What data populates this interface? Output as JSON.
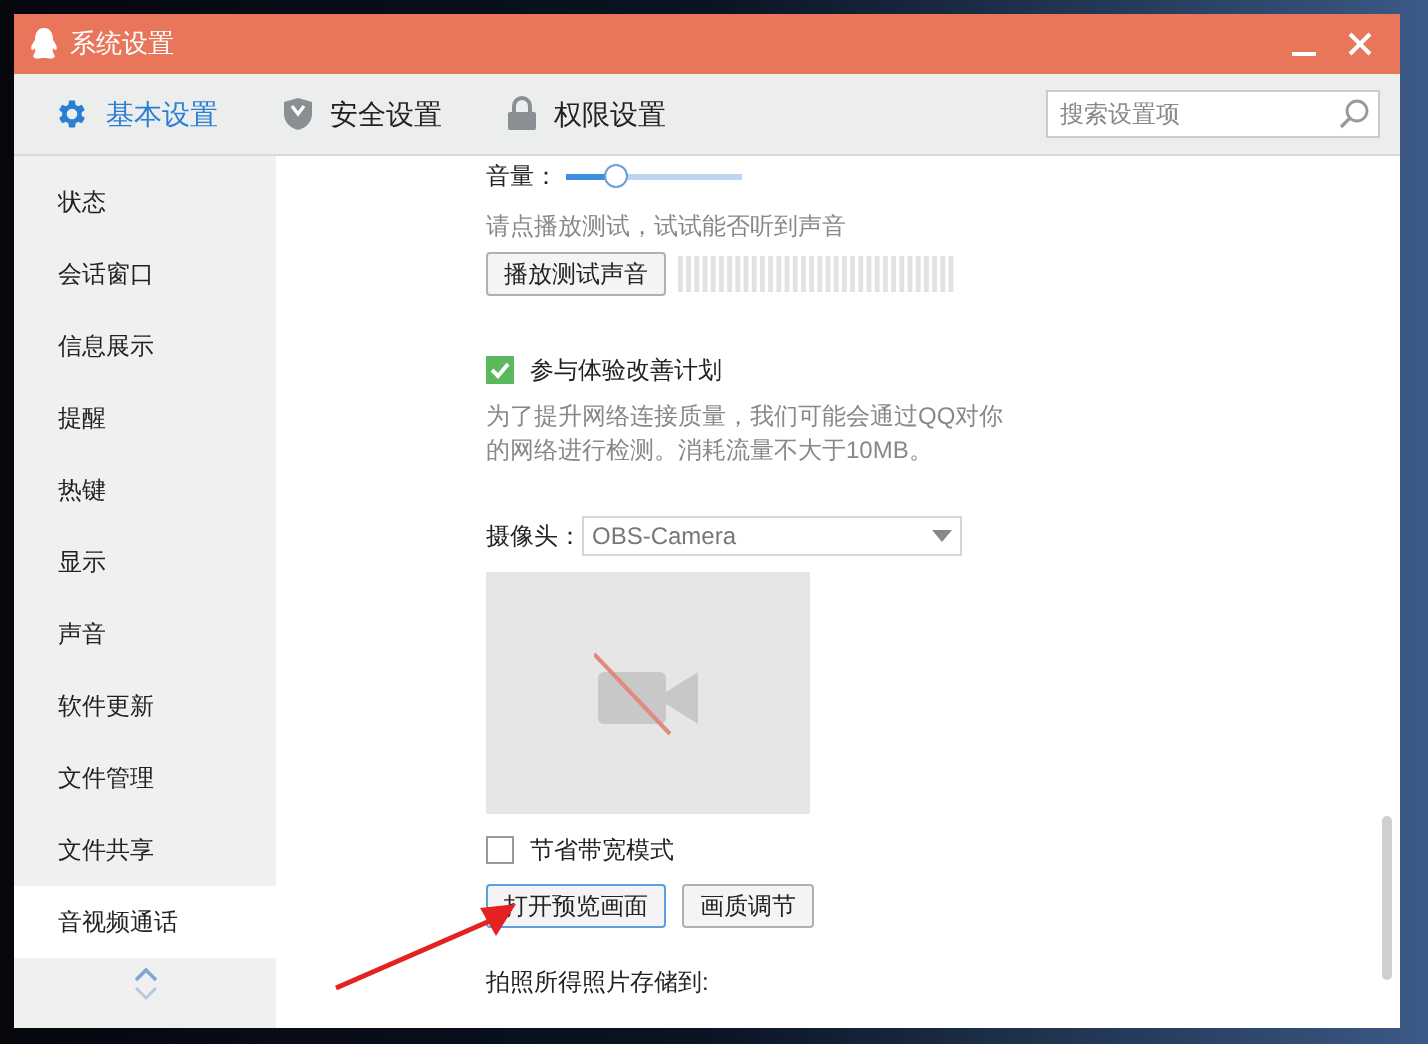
{
  "window": {
    "title": "系统设置"
  },
  "tabs": [
    {
      "label": "基本设置",
      "selected": true
    },
    {
      "label": "安全设置",
      "selected": false
    },
    {
      "label": "权限设置",
      "selected": false
    }
  ],
  "search": {
    "placeholder": "搜索设置项"
  },
  "sidebar": {
    "items": [
      {
        "label": "状态",
        "selected": false
      },
      {
        "label": "会话窗口",
        "selected": false
      },
      {
        "label": "信息展示",
        "selected": false
      },
      {
        "label": "提醒",
        "selected": false
      },
      {
        "label": "热键",
        "selected": false
      },
      {
        "label": "显示",
        "selected": false
      },
      {
        "label": "声音",
        "selected": false
      },
      {
        "label": "软件更新",
        "selected": false
      },
      {
        "label": "文件管理",
        "selected": false
      },
      {
        "label": "文件共享",
        "selected": false
      },
      {
        "label": "音视频通话",
        "selected": true
      }
    ]
  },
  "content": {
    "volume": {
      "label": "音量：",
      "level": 0.25
    },
    "test_hint": "请点播放测试，试试能否听到声音",
    "test_button": "播放测试声音",
    "improve": {
      "label": "参与体验改善计划",
      "checked": true
    },
    "improve_note": "为了提升网络连接质量，我们可能会通过QQ对你的网络进行检测。消耗流量不大于10MB。",
    "camera": {
      "label": "摄像头：",
      "value": "OBS-Camera"
    },
    "bandwidth": {
      "label": "节省带宽模式",
      "checked": false
    },
    "buttons": [
      {
        "label": "打开预览画面",
        "focused": true
      },
      {
        "label": "画质调节",
        "focused": false
      }
    ],
    "photo_label": "拍照所得照片存储到:"
  }
}
